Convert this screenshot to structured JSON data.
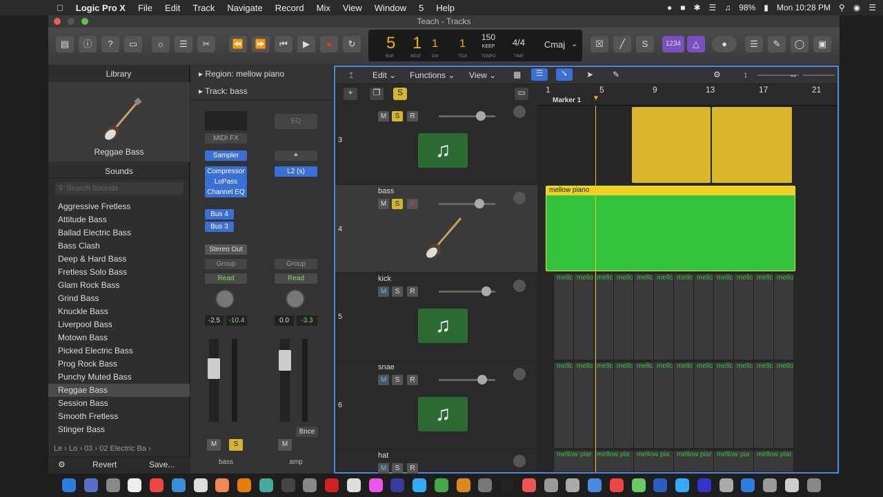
{
  "menubar": {
    "app": "Logic Pro X",
    "items": [
      "File",
      "Edit",
      "Track",
      "Navigate",
      "Record",
      "Mix",
      "View",
      "Window",
      "5",
      "Help"
    ],
    "battery": "98%",
    "clock": "Mon 10:28 PM"
  },
  "window": {
    "title": "Teach - Tracks"
  },
  "lcd": {
    "bar": "5",
    "beat": "1",
    "div": "1",
    "tick": "1",
    "tempo": "150",
    "tempo_mode": "KEEP",
    "signature": "4/4",
    "key": "Cmaj",
    "labels": {
      "bar": "BAR",
      "beat": "BEAT",
      "div": "DIV",
      "tick": "TICK",
      "tempo": "TEMPO",
      "time": "TIME"
    },
    "count_in": "1234"
  },
  "library": {
    "title": "Library",
    "preset_name": "Reggae Bass",
    "sounds_title": "Sounds",
    "search_placeholder": "Search Sounds",
    "items": [
      "Aggressive Fretless",
      "Attitude Bass",
      "Ballad Electric Bass",
      "Bass Clash",
      "Deep & Hard Bass",
      "Fretless Solo Bass",
      "Glam Rock Bass",
      "Grind Bass",
      "Knuckle Bass",
      "Liverpool Bass",
      "Motown Bass",
      "Picked Electric Bass",
      "Prog Rock Bass",
      "Punchy Muted Bass",
      "Reggae Bass",
      "Session Bass",
      "Smooth Fretless",
      "Stinger Bass"
    ],
    "selected": "Reggae Bass",
    "breadcrumb": [
      "Le",
      "Lo",
      "03",
      "02 Electric Ba"
    ],
    "revert": "Revert",
    "save": "Save..."
  },
  "inspector": {
    "region_label": "Region:",
    "region_name": "mellow piano",
    "track_label": "Track:",
    "track_name": "bass",
    "strip1": {
      "midi_fx": "MIDI FX",
      "instrument": "Sampler",
      "effects": [
        "Compressor",
        "LoPass",
        "Channel EQ"
      ],
      "sends": [
        "Bus 4",
        "Bus 3"
      ],
      "output": "Stereo Out",
      "group": "Group",
      "automation": "Read",
      "pan": "-2.5",
      "level": "-10.4",
      "mute": "M",
      "solo": "S",
      "name": "bass"
    },
    "strip2": {
      "eq": "EQ",
      "insert": "L2 (s)",
      "group": "Group",
      "automation": "Read",
      "pan": "0.0",
      "level": "-3.3",
      "mute": "M",
      "bounce": "Bnce",
      "name": "amp"
    }
  },
  "tracks_toolbar": {
    "edit": "Edit",
    "functions": "Functions",
    "view": "View"
  },
  "ruler": {
    "bars": [
      "1",
      "5",
      "9",
      "13",
      "17",
      "21"
    ],
    "marker": "Marker 1"
  },
  "tracks": [
    {
      "number": "3",
      "name": "",
      "mute": "M",
      "solo": "S",
      "rec": "R",
      "volume": 0.55
    },
    {
      "number": "4",
      "name": "bass",
      "mute": "M",
      "solo": "S",
      "rec": "R",
      "volume": 0.5
    },
    {
      "number": "5",
      "name": "kick",
      "mute": "M",
      "solo": "S",
      "rec": "R",
      "volume": 0.6
    },
    {
      "number": "6",
      "name": "snae",
      "mute": "M",
      "solo": "S",
      "rec": "R",
      "volume": 0.55
    },
    {
      "number": "",
      "name": "hat",
      "mute": "M",
      "solo": "S",
      "rec": "R",
      "volume": 0.55
    }
  ],
  "regions": {
    "bass": "mellow piano",
    "kick": [
      "mellc",
      "mello",
      "mellc",
      "mellc",
      "mellc",
      "mellc",
      "mellc",
      "mellc",
      "mellc",
      "mellc",
      "mellc",
      "mello"
    ],
    "snae": [
      "mellc",
      "mellc",
      "mellc",
      "mellc",
      "mellc",
      "mellc",
      "mellc",
      "mellc",
      "mellc",
      "mellc",
      "mellc",
      "mello"
    ],
    "hat": [
      "mellow piar",
      "mellow pia",
      "mellow pia",
      "mellow piar",
      "mellow pia",
      "mellow piar"
    ]
  },
  "colors": {
    "yellow": "#d9b62a",
    "green": "#35c23f",
    "accent": "#4a8ae0",
    "lcd": "#f0b000"
  }
}
